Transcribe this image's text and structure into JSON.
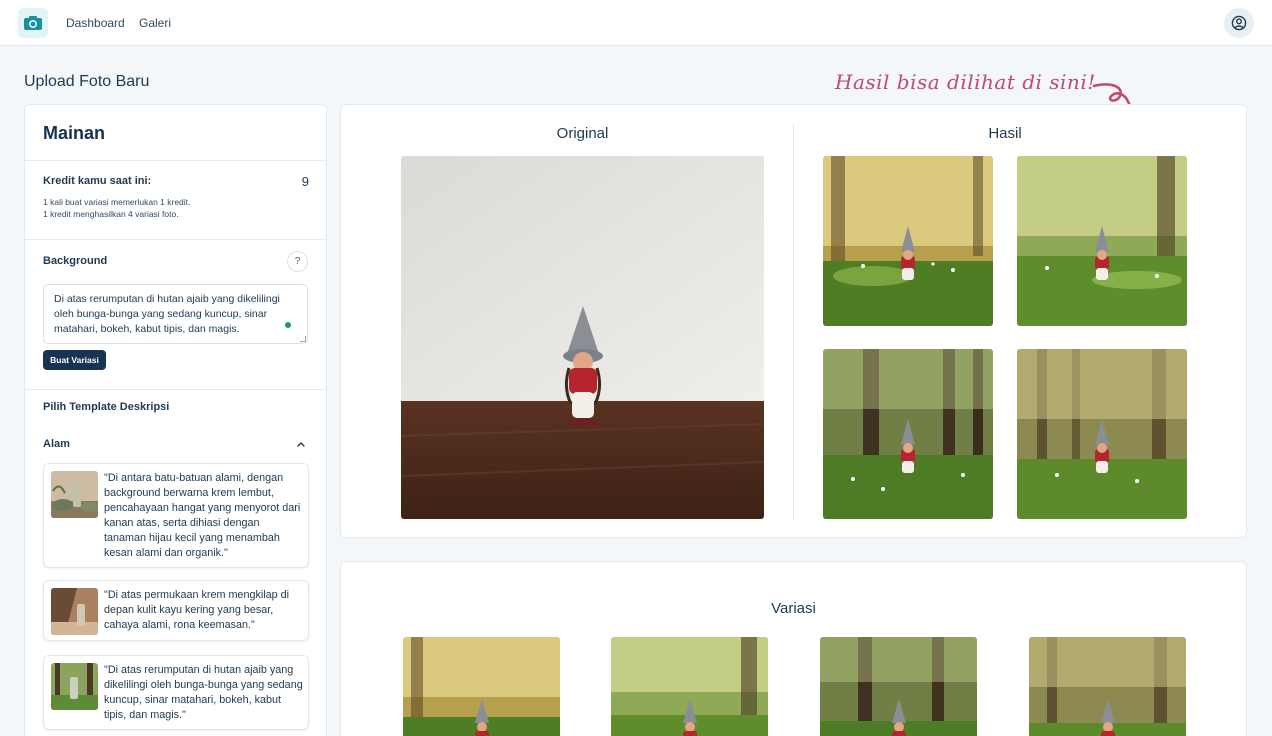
{
  "nav": {
    "links": [
      "Dashboard",
      "Galeri"
    ]
  },
  "page": {
    "title": "Upload Foto Baru",
    "hint": "Hasil bisa dilihat di sini!"
  },
  "sidebar": {
    "title": "Mainan",
    "credit_label": "Kredit kamu saat ini:",
    "credit_value": "9",
    "credit_notes": [
      "1 kali buat variasi memerlukan 1 kredit.",
      "1 kredit menghasilkan 4 variasi foto."
    ],
    "background_label": "Background",
    "help_symbol": "?",
    "background_value": "Di atas rerumputan di hutan ajaib yang dikelilingi oleh bunga-bunga yang sedang kuncup, sinar matahari, bokeh, kabut tipis, dan magis.",
    "make_button": "Buat Variasi",
    "template_label": "Pilih Template Deskripsi",
    "accordion_label": "Alam",
    "templates": [
      "\"Di antara batu-batuan alami, dengan background berwarna krem lembut, pencahayaan hangat yang menyorot dari kanan atas, serta dihiasi dengan tanaman hijau kecil yang menambah kesan alami dan organik.\"",
      "\"Di atas permukaan krem mengkilap di depan kulit kayu kering yang besar, cahaya alami, rona keemasan.\"",
      "\"Di atas rerumputan di hutan ajaib yang dikelilingi oleh bunga-bunga yang sedang kuncup, sinar matahari, bokeh, kabut tipis, dan magis.\""
    ]
  },
  "result": {
    "original_title": "Original",
    "result_title": "Hasil",
    "variations_title": "Variasi"
  },
  "icons": {
    "logo": "camera-icon",
    "avatar": "user-circle-icon",
    "accordion": "chevron-up-icon",
    "hint_arrow": "curly-arrow-icon"
  },
  "colors": {
    "accent_dark": "#173552",
    "hint_pink": "#c24a6e",
    "logo_teal": "#1b8fa0",
    "status_green": "#159a74"
  }
}
